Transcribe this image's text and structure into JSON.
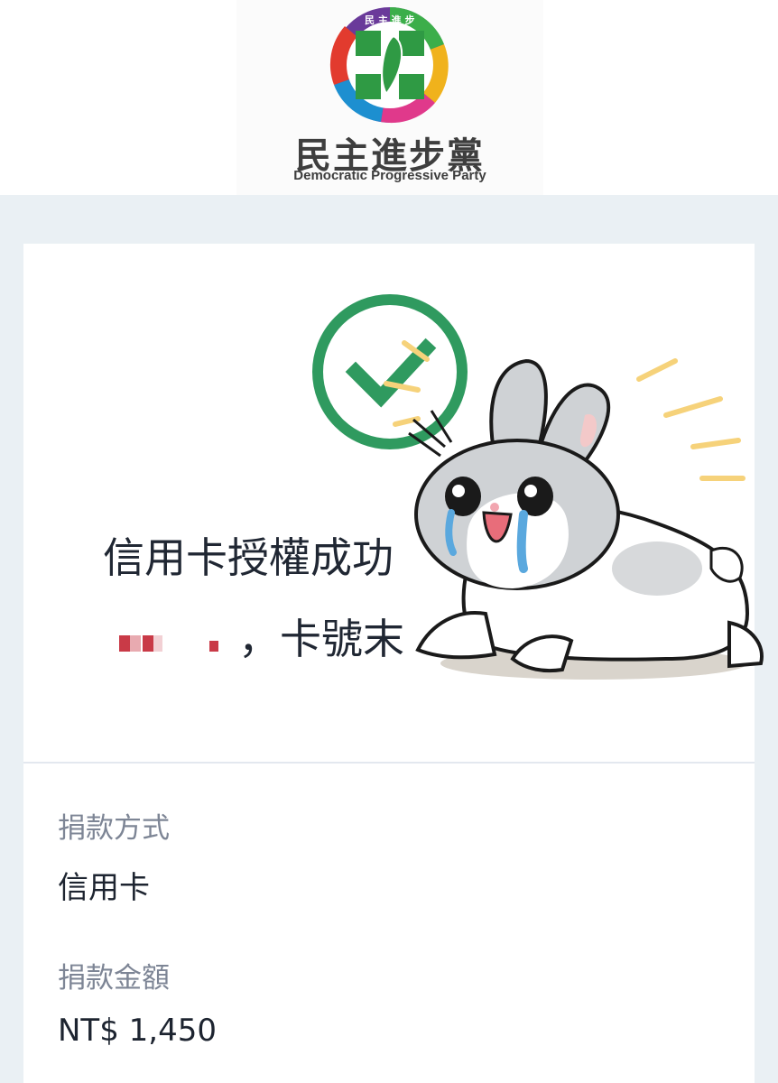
{
  "header": {
    "logo_zh": "民主進步黨",
    "logo_en": "Democratic Progressive Party",
    "ring_text_zh": "民主進步黨",
    "ring_text_en": "DEMOCRATIC PROGRESSIVE PARTY"
  },
  "result": {
    "title": "信用卡授權成功",
    "line2": "，卡號末"
  },
  "details": [
    {
      "label": "捐款方式",
      "value": "信用卡"
    },
    {
      "label": "捐款金額",
      "value": "NT$ 1,450"
    }
  ],
  "colors": {
    "success": "#2f9a5f",
    "background": "#eaf0f4",
    "text": "#202733",
    "label": "#7d8595"
  },
  "icons": [
    "check-circle-icon",
    "party-logo",
    "crying-bunny-sticker"
  ]
}
